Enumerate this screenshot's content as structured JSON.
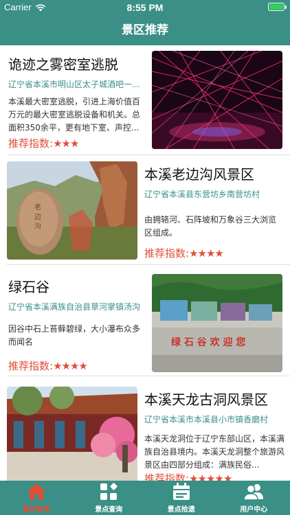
{
  "status": {
    "carrier": "Carrier",
    "time": "8:55 PM"
  },
  "nav": {
    "title": "景区推荐"
  },
  "colors": {
    "primary": "#3a8f86",
    "accent": "#e04e38",
    "battery": "#2fd158"
  },
  "rating_label": "推荐指数:",
  "spots": [
    {
      "title": "诡迹之雾密室逃脱",
      "address": "辽宁省本溪市明山区太子城酒吧一...",
      "description": "本溪最大密室逃脱，引进上海价值百万元的最大密室逃脱设备和机关。总面积350余平，更有地下室、声控...",
      "stars": "★★★",
      "rating_value": 3,
      "image_icon": "laser-nightclub-photo"
    },
    {
      "title": "本溪老边沟风景区",
      "address": "辽宁省本溪县东营坊乡南营坊村",
      "description": "由拥辂河、石阵坡和万象谷三大浏览区组成。",
      "stars": "★★★★",
      "rating_value": 4,
      "image_icon": "carved-stone-mountain-photo"
    },
    {
      "title": "绿石谷",
      "address": "辽宁省本溪满族自治县草河掌镇汤沟",
      "description": "因谷中石上苔藓碧绿，大小瀑布众多而闻名",
      "stars": "★★★★",
      "rating_value": 4,
      "image_icon": "welcome-wall-photo",
      "image_caption": "绿 石 谷 欢 迎 您"
    },
    {
      "title": "本溪天龙古洞风景区",
      "address": "辽宁省本溪市本溪县小市镇香磨村",
      "description": "本溪天龙洞位于辽宁东部山区，本溪满族自治县境内。本溪天龙洞整个旅游风景区由四部分组成：满族民俗...",
      "stars": "★★★★★",
      "rating_value": 5,
      "image_icon": "temple-blossom-photo"
    }
  ],
  "tabs": [
    {
      "label": "景区推荐",
      "icon": "home-icon",
      "active": true
    },
    {
      "label": "景点查询",
      "icon": "grid-apps-icon",
      "active": false
    },
    {
      "label": "景点拾遗",
      "icon": "calendar-icon",
      "active": false
    },
    {
      "label": "用户中心",
      "icon": "users-icon",
      "active": false
    }
  ]
}
